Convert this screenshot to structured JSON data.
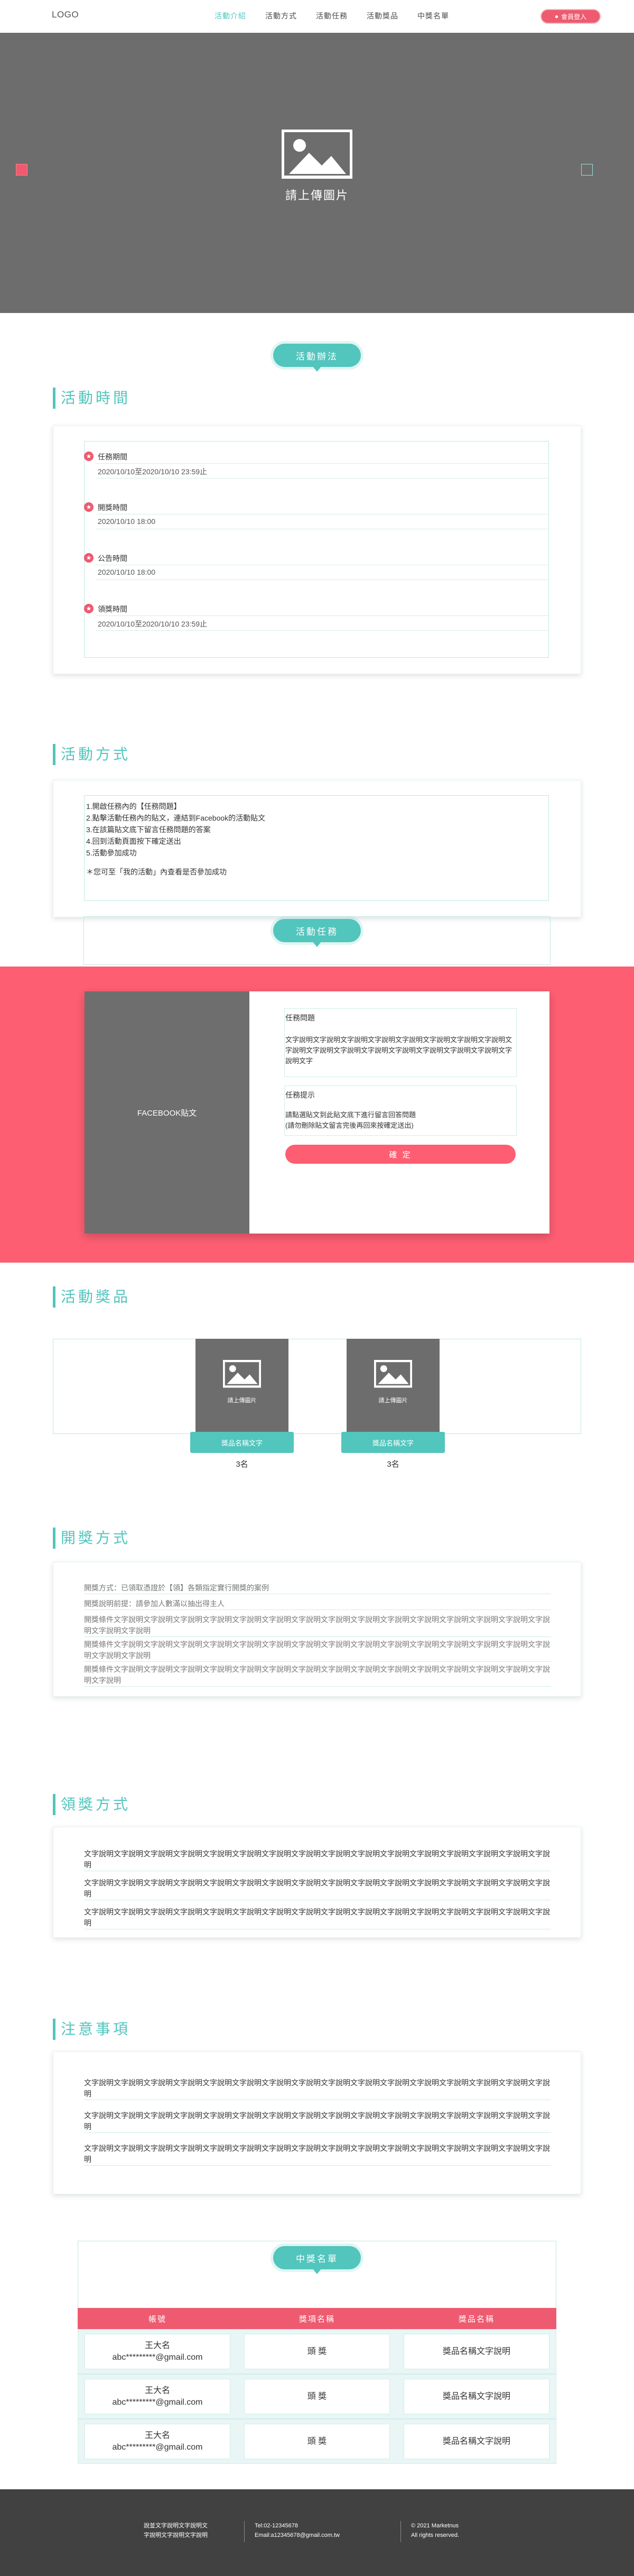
{
  "header": {
    "logo": "LOGO",
    "nav": [
      "活動介紹",
      "活動方式",
      "活動任務",
      "活動獎品",
      "中獎名單"
    ],
    "join_label": "會員登入"
  },
  "banner": {
    "upload_text": "請上傳圖片"
  },
  "intro": {
    "pill": "活動辦法"
  },
  "time": {
    "title": "活動時間",
    "items": [
      {
        "label": "任務期間",
        "value": "2020/10/10至2020/10/10 23:59止"
      },
      {
        "label": "開獎時間",
        "value": "2020/10/10 18:00"
      },
      {
        "label": "公告時間",
        "value": "2020/10/10 18:00"
      },
      {
        "label": "領獎時間",
        "value": "2020/10/10至2020/10/10 23:59止"
      }
    ]
  },
  "method": {
    "title": "活動方式",
    "lines": [
      "1.開啟任務內的【任務問題】",
      "2.點擊活動任務內的貼文，連結到Facebook的活動貼文",
      "3.在該篇貼文底下留言任務問題的答案",
      "4.回到活動頁面按下確定送出",
      "5.活動參加成功"
    ],
    "note": "＊您可至「我的活動」內查看是否參加成功"
  },
  "task": {
    "pill": "活動任務",
    "fb_label": "FACEBOOK貼文",
    "q_label": "任務問題",
    "q_text": "文字說明文字說明文字說明文字說明文字說明文字說明文字說明文字說明文字說明文字說明文字說明文字說明文字說明文字說明文字說明文字說明文字說明文字",
    "hint_label": "任務提示",
    "hint_text": "請點選貼文到此貼文底下進行留言回答問題\n(請勿刪除貼文留言完後再回來按確定送出)",
    "button": "確 定"
  },
  "prizes": {
    "title": "活動獎品",
    "items": [
      {
        "name": "獎品名稱文字",
        "upload": "請上傳圖片",
        "qty": "3名"
      },
      {
        "name": "獎品名稱文字",
        "upload": "請上傳圖片",
        "qty": "3名"
      }
    ]
  },
  "lottery": {
    "title": "開獎方式",
    "rows": [
      "開獎方式：已領取憑證於【領】各類指定實行開獎的案例",
      "開獎說明前提：請參加人數滿以抽出得主人",
      "開獎條件文字說明文字說明文字說明文字說明文字說明文字說明文字說明文字說明文字說明文字說明文字說明文字說明文字說明文字說明文字說明文字說明文字說明",
      "開獎條件文字說明文字說明文字說明文字說明文字說明文字說明文字說明文字說明文字說明文字說明文字說明文字說明文字說明文字說明文字說明文字說明文字說明",
      "開獎條件文字說明文字說明文字說明文字說明文字說明文字說明文字說明文字說明文字說明文字說明文字說明文字說明文字說明文字說明文字說明文字說明"
    ]
  },
  "claim": {
    "title": "領獎方式",
    "rows": [
      "文字說明文字說明文字說明文字說明文字說明文字說明文字說明文字說明文字說明文字說明文字說明文字說明文字說明文字說明文字說明文字說明",
      "文字說明文字說明文字說明文字說明文字說明文字說明文字說明文字說明文字說明文字說明文字說明文字說明文字說明文字說明文字說明文字說明",
      "文字說明文字說明文字說明文字說明文字說明文字說明文字說明文字說明文字說明文字說明文字說明文字說明文字說明文字說明文字說明文字說明"
    ]
  },
  "notes": {
    "title": "注意事項",
    "rows": [
      "文字說明文字說明文字說明文字說明文字說明文字說明文字說明文字說明文字說明文字說明文字說明文字說明文字說明文字說明文字說明文字說明",
      "文字說明文字說明文字說明文字說明文字說明文字說明文字說明文字說明文字說明文字說明文字說明文字說明文字說明文字說明文字說明文字說明",
      "文字說明文字說明文字說明文字說明文字說明文字說明文字說明文字說明文字說明文字說明文字說明文字說明文字說明文字說明文字說明文字說明"
    ]
  },
  "winners": {
    "pill": "中獎名單",
    "headers": [
      "帳號",
      "獎項名稱",
      "獎品名稱"
    ],
    "rows": [
      {
        "name": "王大名",
        "email": "abc*********@gmail.com",
        "award": "頭 獎",
        "prize": "獎品名稱文字說明"
      },
      {
        "name": "王大名",
        "email": "abc*********@gmail.com",
        "award": "頭 獎",
        "prize": "獎品名稱文字說明"
      },
      {
        "name": "王大名",
        "email": "abc*********@gmail.com",
        "award": "頭 獎",
        "prize": "獎品名稱文字說明"
      }
    ]
  },
  "footer": {
    "company_1": "說並文字說明文字說明文",
    "company_2": "字說明文字說明文字說明",
    "tel": "Tel:02-12345678",
    "email": "Email:a12345678@gmail.com.tw",
    "copyright_1": "© 2021 Marketnus",
    "copyright_2": "All rights reserved."
  },
  "colors": {
    "accent": "#52c5bd",
    "brand": "#ee5a6f",
    "band": "#fd5e72",
    "placeholder": "#6d6d6d"
  }
}
